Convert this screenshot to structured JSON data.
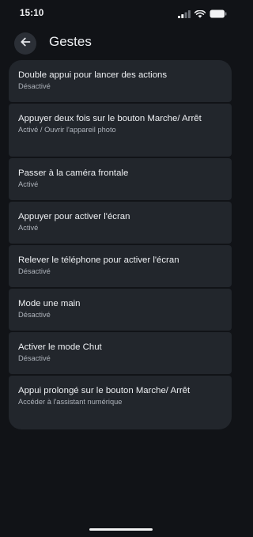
{
  "status_bar": {
    "time": "15:10",
    "icons": [
      "signal-icon",
      "wifi-icon",
      "battery-icon"
    ]
  },
  "app_bar": {
    "back_icon": "arrow-left-icon",
    "title": "Gestes"
  },
  "settings": [
    {
      "title": "Double appui pour lancer des actions",
      "subtitle": "Désactivé"
    },
    {
      "title": "Appuyer deux fois sur le bouton Marche/ Arrêt",
      "subtitle": "Activé / Ouvrir l'appareil photo"
    },
    {
      "title": "Passer à la caméra frontale",
      "subtitle": "Activé"
    },
    {
      "title": "Appuyer pour activer l'écran",
      "subtitle": "Activé"
    },
    {
      "title": "Relever le téléphone pour activer l'écran",
      "subtitle": "Désactivé"
    },
    {
      "title": "Mode une main",
      "subtitle": "Désactivé"
    },
    {
      "title": "Activer le mode Chut",
      "subtitle": "Désactivé"
    },
    {
      "title": "Appui prolongé sur le bouton Marche/ Arrêt",
      "subtitle": "Accéder à l'assistant numérique"
    }
  ],
  "colors": {
    "background": "#111317",
    "card": "#22262c",
    "text": "#eef0f3",
    "subtext": "#aeb3bb"
  }
}
